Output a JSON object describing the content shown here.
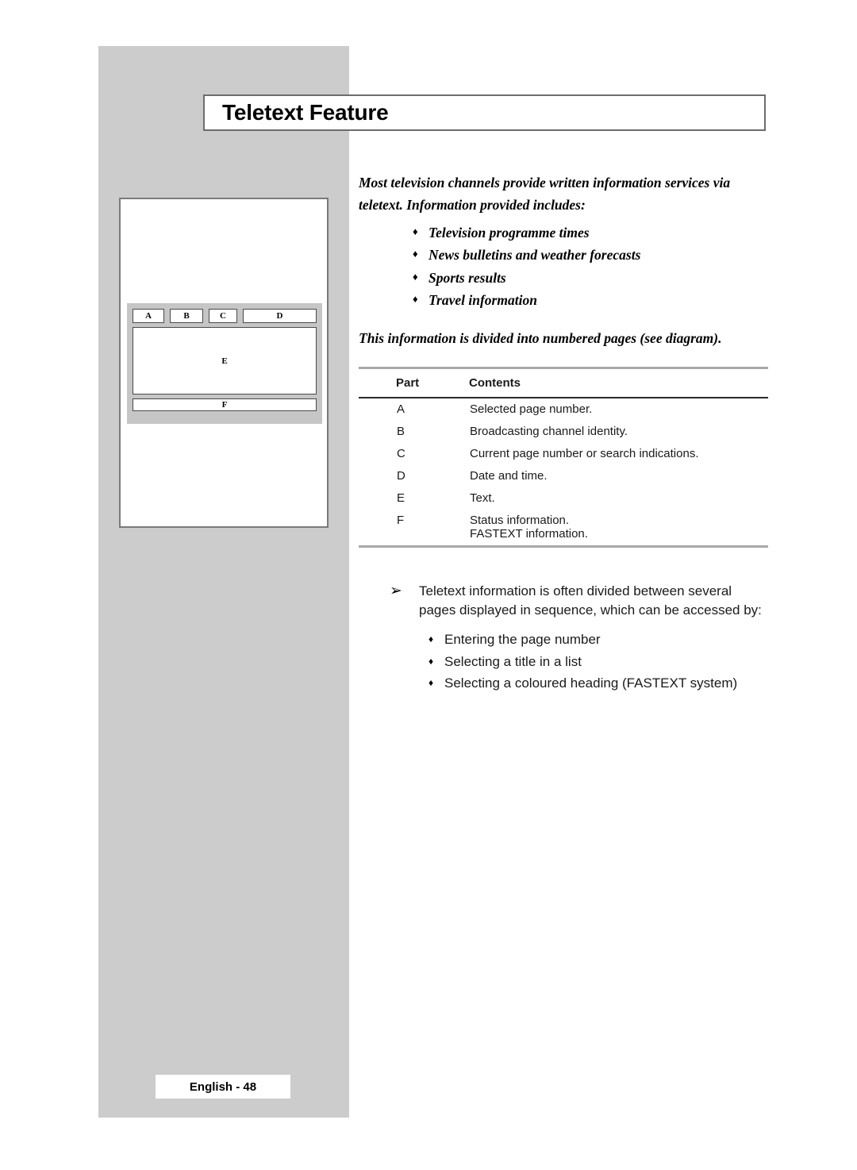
{
  "page": {
    "title": "Teletext Feature",
    "footer_label": "English - 48",
    "accent_grey": "#cccccc",
    "rule_grey": "#a8a8a8",
    "border_grey": "#6d6d6d"
  },
  "diagram": {
    "name": "teletext-page-layout",
    "segments": {
      "a": "A",
      "b": "B",
      "c": "C",
      "d": "D",
      "e": "E",
      "f": "F"
    }
  },
  "intro": {
    "paragraph": "Most television channels provide written information services via teletext. Information provided includes:",
    "bullet_glyph": "♦",
    "items": [
      "Television programme times",
      "News bulletins and weather forecasts",
      "Sports results",
      "Travel information"
    ],
    "closing": "This information is divided into numbered pages (see diagram)."
  },
  "table": {
    "headers": {
      "part": "Part",
      "contents": "Contents"
    },
    "rows": [
      {
        "part": "A",
        "contents": "Selected page number."
      },
      {
        "part": "B",
        "contents": "Broadcasting channel identity."
      },
      {
        "part": "C",
        "contents": "Current page number or search indications."
      },
      {
        "part": "D",
        "contents": "Date and time."
      },
      {
        "part": "E",
        "contents": "Text."
      },
      {
        "part": "F",
        "contents": "Status information.\nFASTEXT information."
      }
    ]
  },
  "note": {
    "arrow_glyph": "➢",
    "paragraph": "Teletext information is often divided between several pages displayed in sequence, which can be accessed by:",
    "bullet_glyph": "♦",
    "items": [
      "Entering the page number",
      "Selecting a title in a list",
      "Selecting a coloured heading (FASTEXT system)"
    ]
  }
}
